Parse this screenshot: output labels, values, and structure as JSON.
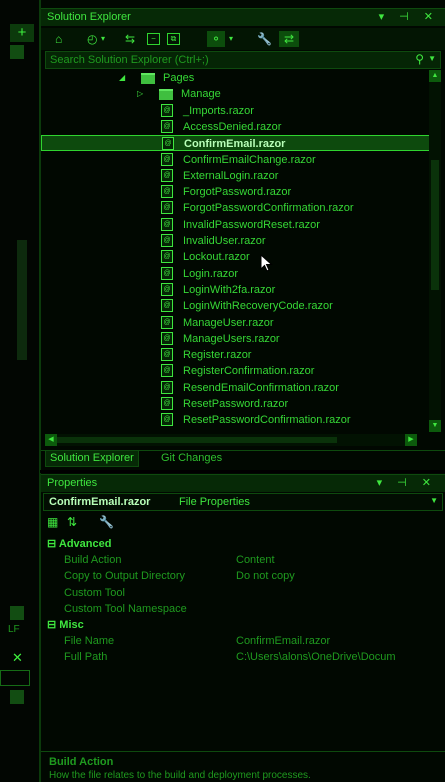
{
  "solution_explorer": {
    "title": "Solution Explorer",
    "title_buttons": "▾ ⊣ ✕",
    "search_placeholder": "Search Solution Explorer (Ctrl+;)",
    "tree": [
      {
        "label": "Pages",
        "type": "folder",
        "expanded": true,
        "indent": 0
      },
      {
        "label": "Manage",
        "type": "folder",
        "expanded": false,
        "indent": 1
      },
      {
        "label": "_Imports.razor",
        "type": "file",
        "indent": 2
      },
      {
        "label": "AccessDenied.razor",
        "type": "file",
        "indent": 2
      },
      {
        "label": "ConfirmEmail.razor",
        "type": "file",
        "indent": 2,
        "selected": true
      },
      {
        "label": "ConfirmEmailChange.razor",
        "type": "file",
        "indent": 2
      },
      {
        "label": "ExternalLogin.razor",
        "type": "file",
        "indent": 2
      },
      {
        "label": "ForgotPassword.razor",
        "type": "file",
        "indent": 2
      },
      {
        "label": "ForgotPasswordConfirmation.razor",
        "type": "file",
        "indent": 2
      },
      {
        "label": "InvalidPasswordReset.razor",
        "type": "file",
        "indent": 2
      },
      {
        "label": "InvalidUser.razor",
        "type": "file",
        "indent": 2
      },
      {
        "label": "Lockout.razor",
        "type": "file",
        "indent": 2
      },
      {
        "label": "Login.razor",
        "type": "file",
        "indent": 2
      },
      {
        "label": "LoginWith2fa.razor",
        "type": "file",
        "indent": 2
      },
      {
        "label": "LoginWithRecoveryCode.razor",
        "type": "file",
        "indent": 2
      },
      {
        "label": "ManageUser.razor",
        "type": "file",
        "indent": 2
      },
      {
        "label": "ManageUsers.razor",
        "type": "file",
        "indent": 2
      },
      {
        "label": "Register.razor",
        "type": "file",
        "indent": 2
      },
      {
        "label": "RegisterConfirmation.razor",
        "type": "file",
        "indent": 2
      },
      {
        "label": "ResendEmailConfirmation.razor",
        "type": "file",
        "indent": 2
      },
      {
        "label": "ResetPassword.razor",
        "type": "file",
        "indent": 2
      },
      {
        "label": "ResetPasswordConfirmation.razor",
        "type": "file",
        "indent": 2
      }
    ],
    "tabs": [
      {
        "label": "Solution Explorer",
        "active": true
      },
      {
        "label": "Git Changes",
        "active": false
      }
    ]
  },
  "properties": {
    "title": "Properties",
    "title_buttons": "▾ ⊣ ✕",
    "object_name": "ConfirmEmail.razor",
    "object_type": "File Properties",
    "rows": [
      {
        "kind": "category",
        "label": "Advanced"
      },
      {
        "kind": "prop",
        "key": "Build Action",
        "value": "Content"
      },
      {
        "kind": "prop",
        "key": "Copy to Output Directory",
        "value": "Do not copy"
      },
      {
        "kind": "prop",
        "key": "Custom Tool",
        "value": ""
      },
      {
        "kind": "prop",
        "key": "Custom Tool Namespace",
        "value": ""
      },
      {
        "kind": "category",
        "label": "Misc"
      },
      {
        "kind": "prop",
        "key": "File Name",
        "value": "ConfirmEmail.razor"
      },
      {
        "kind": "prop",
        "key": "Full Path",
        "value": "C:\\Users\\alons\\OneDrive\\Docum"
      }
    ],
    "description_title": "Build Action",
    "description_text": "How the file relates to the build and deployment processes."
  },
  "left_strip": {
    "lf_label": "LF"
  },
  "colors": {
    "accent": "#2fd42f",
    "background": "#010801",
    "selection": "#0d4a0d"
  }
}
